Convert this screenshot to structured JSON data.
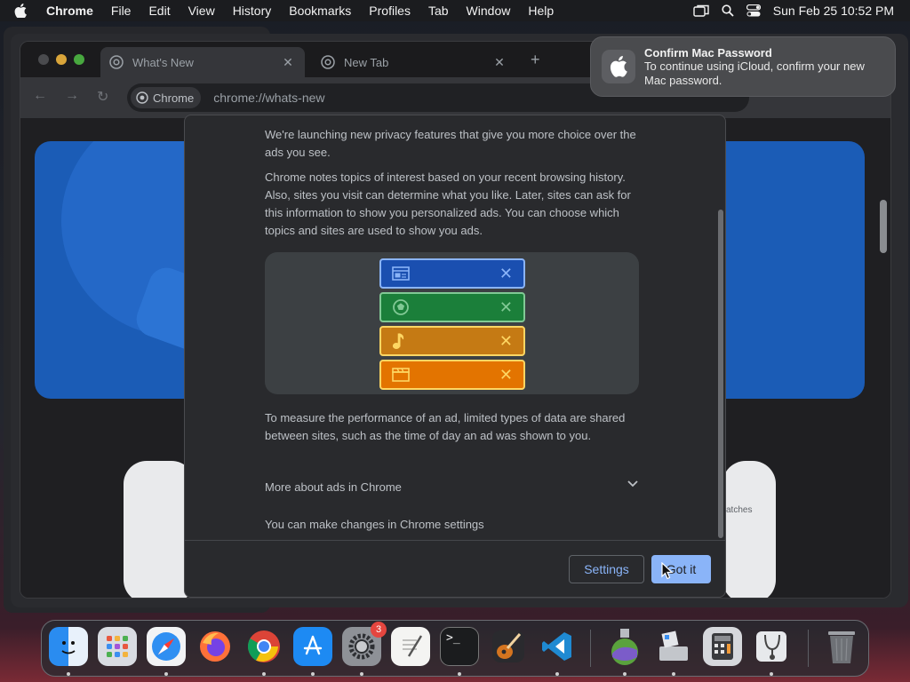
{
  "menubar": {
    "app": "Chrome",
    "items": [
      "File",
      "Edit",
      "View",
      "History",
      "Bookmarks",
      "Profiles",
      "Tab",
      "Window",
      "Help"
    ],
    "clock": "Sun Feb 25  10:52 PM"
  },
  "browser": {
    "tabs": [
      {
        "label": "What's New"
      },
      {
        "label": "New Tab"
      }
    ],
    "chip_label": "Chrome",
    "url": "chrome://whats-new"
  },
  "background_card": {
    "text": "atches"
  },
  "dialog": {
    "para1": "We're launching new privacy features that give you more choice over the ads you see.",
    "para2": "Chrome notes topics of interest based on your recent browsing history. Also, sites you visit can determine what you like. Later, sites can ask for this information to show you personalized ads. You can choose which topics and sites are used to show you ads.",
    "topics": [
      {
        "icon": "newspaper-icon",
        "color": "#8ab4f8",
        "bg": "#1a4fb0"
      },
      {
        "icon": "soccer-ball-icon",
        "color": "#81c995",
        "bg": "#1b7f3a"
      },
      {
        "icon": "music-note-icon",
        "color": "#fdd663",
        "bg": "#c57a14"
      },
      {
        "icon": "clapperboard-icon",
        "color": "#fdd663",
        "bg": "#e37400"
      }
    ],
    "para3": "To measure the performance of an ad, limited types of data are shared between sites, such as the time of day an ad was shown to you.",
    "more_label": "More about ads in Chrome",
    "changes_text": "You can make changes in Chrome settings",
    "settings_button": "Settings",
    "got_it_button": "Got it"
  },
  "notification": {
    "title": "Confirm Mac Password",
    "body": "To continue using iCloud, confirm your new Mac password."
  },
  "dock": {
    "apps": [
      {
        "name": "Finder",
        "icon": "finder-icon"
      },
      {
        "name": "Launchpad",
        "icon": "launchpad-icon"
      },
      {
        "name": "Safari",
        "icon": "safari-icon"
      },
      {
        "name": "Firefox",
        "icon": "firefox-icon"
      },
      {
        "name": "Google Chrome",
        "icon": "chrome-icon"
      },
      {
        "name": "App Store",
        "icon": "app-store-icon"
      },
      {
        "name": "System Settings",
        "icon": "system-settings-icon",
        "badge": "3"
      },
      {
        "name": "TextEdit",
        "icon": "textedit-icon"
      },
      {
        "name": "Terminal",
        "icon": "terminal-icon"
      },
      {
        "name": "GarageBand",
        "icon": "garageband-icon"
      },
      {
        "name": "Visual Studio Code",
        "icon": "vscode-icon"
      },
      {
        "name": "macOS Installer",
        "icon": "installer-icon"
      },
      {
        "name": "Boot Camp Assistant",
        "icon": "bootcamp-icon"
      },
      {
        "name": "Calculator",
        "icon": "calculator-icon"
      },
      {
        "name": "Disk Utility",
        "icon": "disk-utility-icon"
      },
      {
        "name": "Trash",
        "icon": "trash-icon"
      }
    ]
  }
}
